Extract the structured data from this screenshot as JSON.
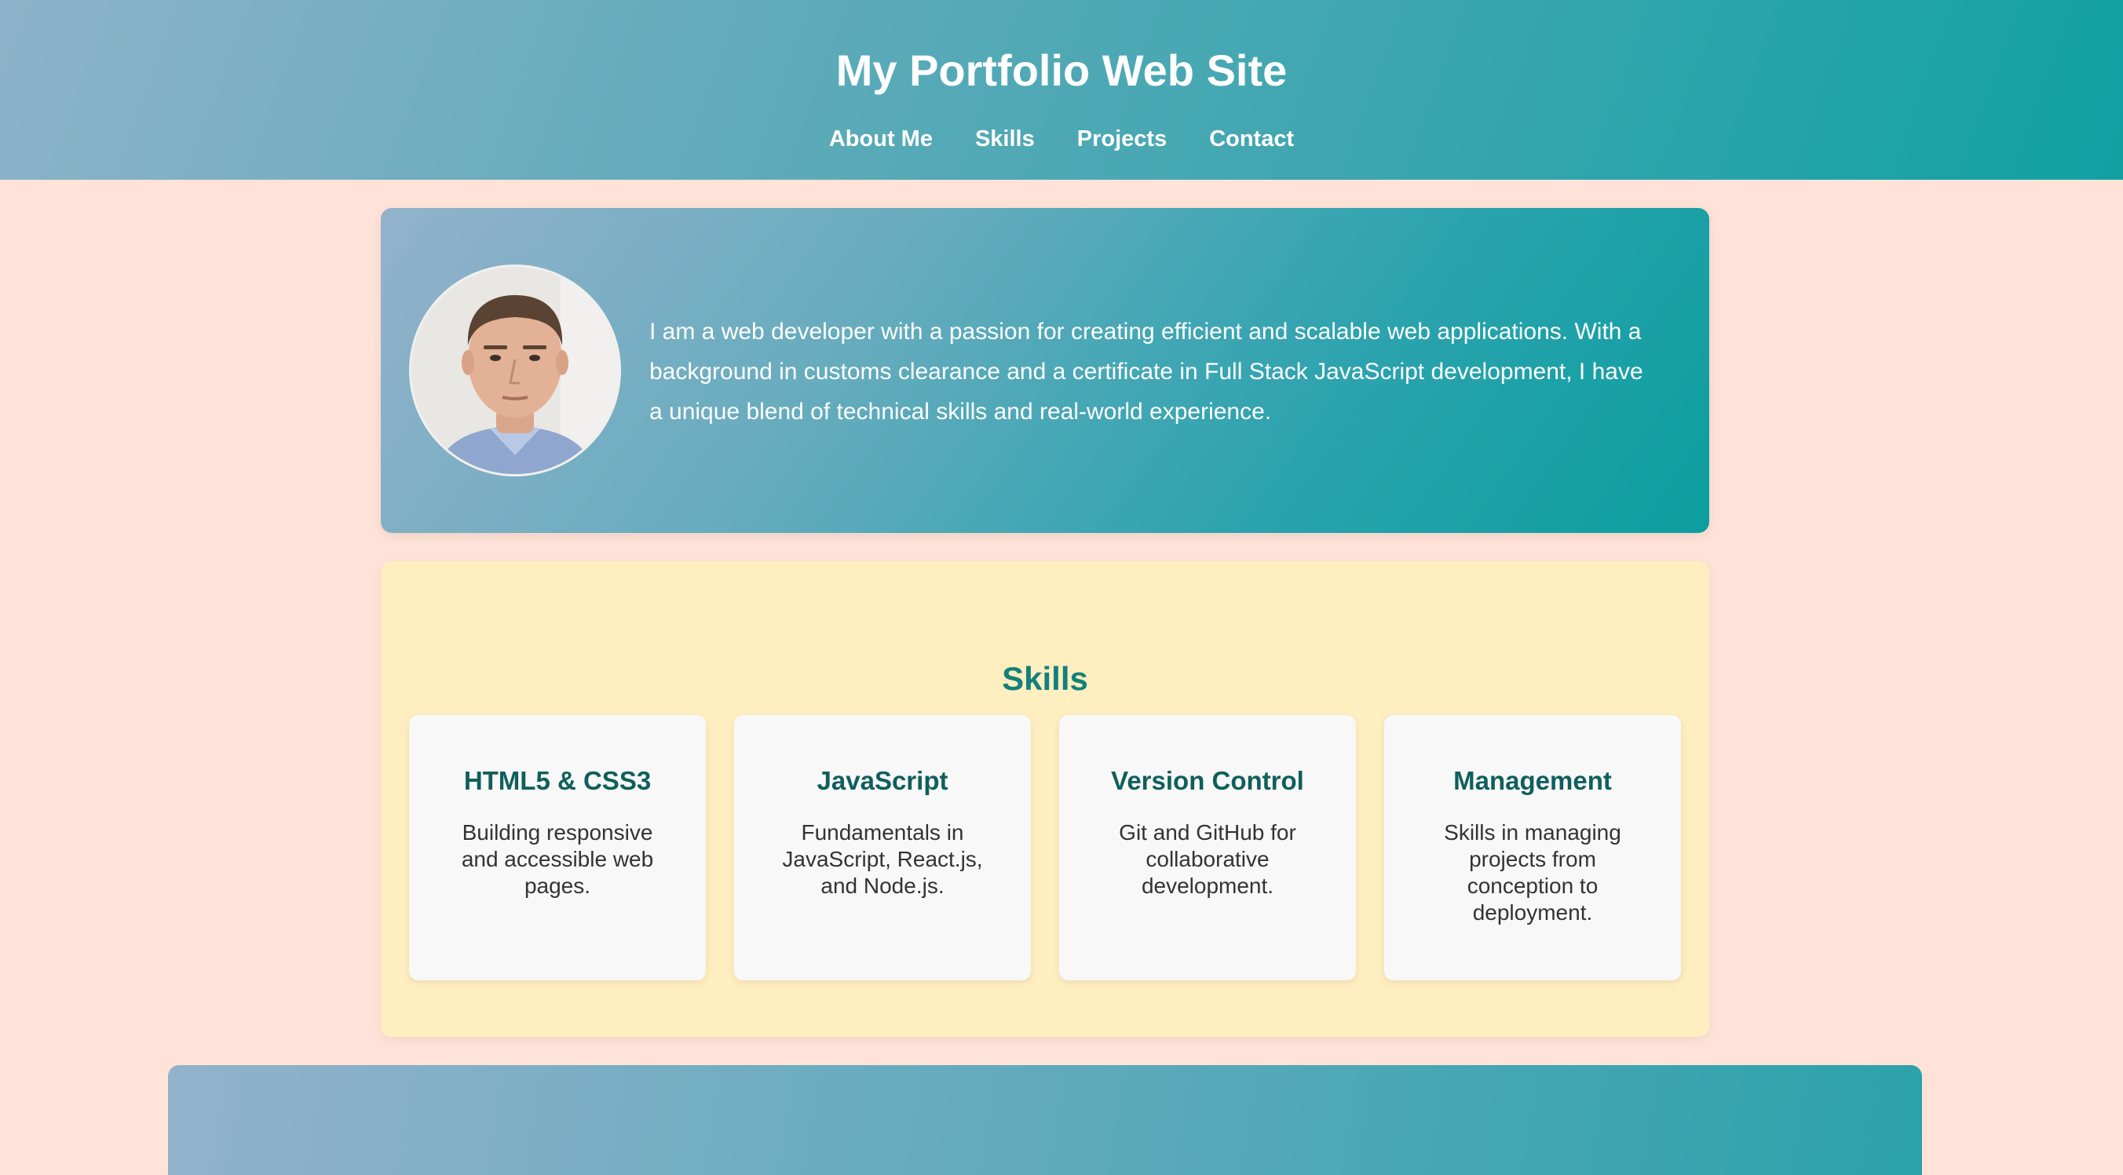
{
  "header": {
    "title": "My Portfolio Web Site",
    "nav": [
      "About Me",
      "Skills",
      "Projects",
      "Contact"
    ]
  },
  "about": {
    "avatar_icon": "profile-photo",
    "text": "I am a web developer with a passion for creating efficient and scalable web applications. With a background in customs clearance and a certificate in Full Stack JavaScript development, I have a unique blend of technical skills and real-world experience."
  },
  "skills": {
    "heading": "Skills",
    "items": [
      {
        "title": "HTML5 & CSS3",
        "desc": "Building responsive and accessible web pages."
      },
      {
        "title": "JavaScript",
        "desc": "Fundamentals in JavaScript, React.js, and Node.js."
      },
      {
        "title": "Version Control",
        "desc": "Git and GitHub for collaborative development."
      },
      {
        "title": "Management",
        "desc": "Skills in managing projects from conception to deployment."
      }
    ]
  },
  "colors": {
    "page_background": "#FFE3D8",
    "header_gradient_start": "#8DB3C9",
    "header_gradient_end": "#10A1A3",
    "skills_background": "#FFEEC0",
    "skills_heading": "#13807C",
    "skill_title": "#0F5F5C",
    "card_background": "#F8F8F8"
  }
}
